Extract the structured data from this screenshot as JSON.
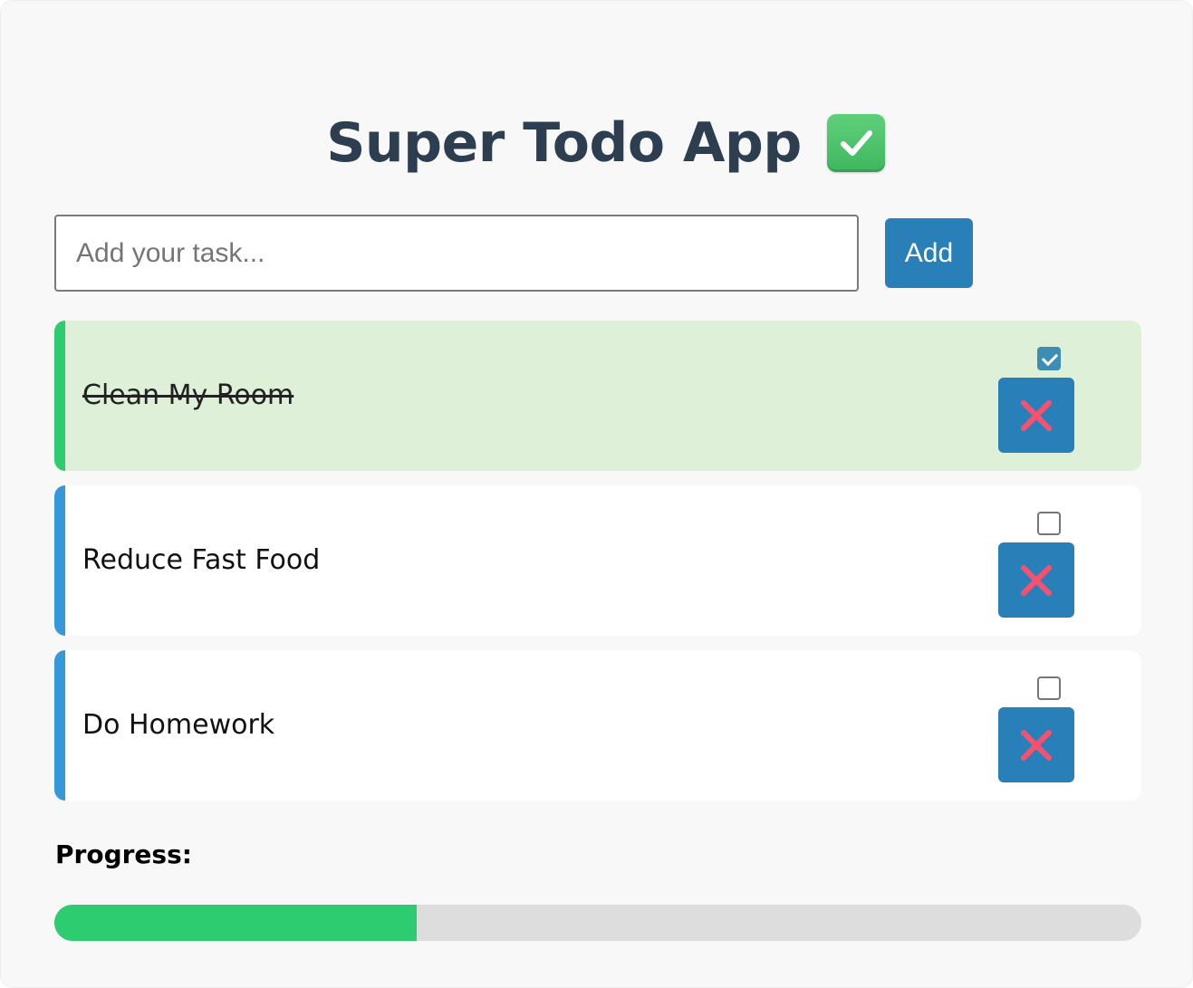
{
  "header": {
    "title": "Super Todo App",
    "title_icon": "check-mark-button-icon"
  },
  "new_task": {
    "placeholder": "Add your task...",
    "value": "",
    "add_label": "Add"
  },
  "tasks": [
    {
      "text": "Clean My Room",
      "completed": true,
      "delete_icon": "cross-mark-icon"
    },
    {
      "text": "Reduce Fast Food",
      "completed": false,
      "delete_icon": "cross-mark-icon"
    },
    {
      "text": "Do Homework",
      "completed": false,
      "delete_icon": "cross-mark-icon"
    }
  ],
  "progress": {
    "label": "Progress:",
    "fraction": 0.3333
  },
  "colors": {
    "title": "#2c3e50",
    "accent": "#2980b9",
    "pending_border": "#3498db",
    "done_border": "#2ecc71",
    "done_background": "#dff0d8",
    "progress_fill": "#2ecc71",
    "progress_track": "#dddddd",
    "delete_cross": "#f7516f"
  }
}
